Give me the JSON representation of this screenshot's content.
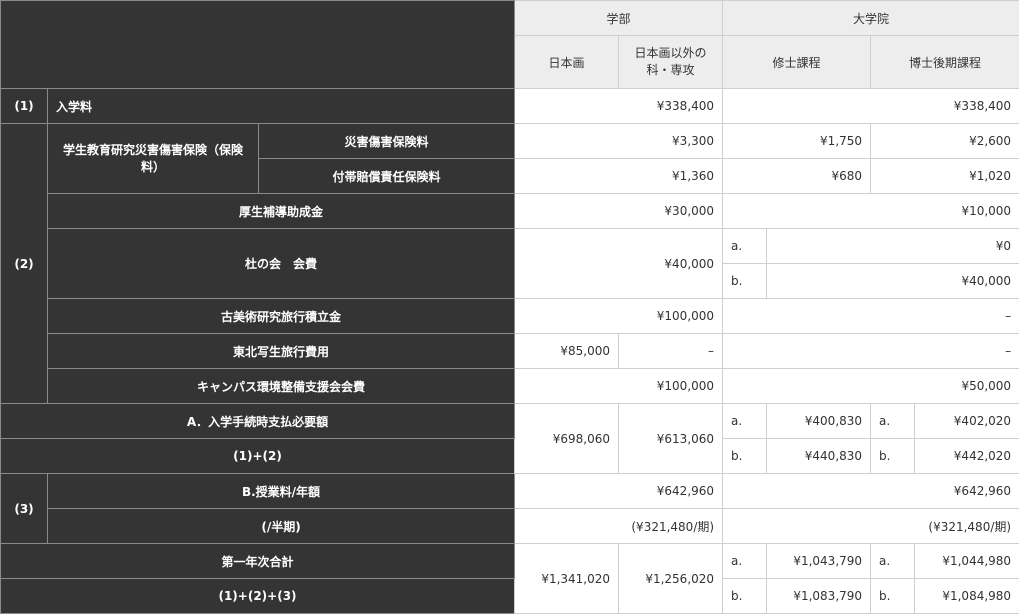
{
  "header": {
    "undergrad": "学部",
    "grad": "大学院",
    "nihonga": "日本画",
    "other_major": "日本画以外の科・専攻",
    "masters": "修士課程",
    "doctoral": "博士後期課程"
  },
  "row1": {
    "no": "(1)",
    "label": "入学料",
    "undergrad": "¥338,400",
    "grad": "¥338,400"
  },
  "group2": {
    "no": "(2)",
    "insurance_label": "学生教育研究災害傷害保険（保険料）",
    "disaster": {
      "label": "災害傷害保険料",
      "undergrad": "¥3,300",
      "masters": "¥1,750",
      "doctoral": "¥2,600"
    },
    "liability": {
      "label": "付帯賠償責任保険料",
      "undergrad": "¥1,360",
      "masters": "¥680",
      "doctoral": "¥1,020"
    },
    "welfare": {
      "label": "厚生補導助成金",
      "undergrad": "¥30,000",
      "grad": "¥10,000"
    },
    "mori": {
      "label": "杜の会　会費",
      "undergrad": "¥40,000",
      "a_mark": "a.",
      "a_value": "¥0",
      "b_mark": "b.",
      "b_value": "¥40,000"
    },
    "old_art": {
      "label": "古美術研究旅行積立金",
      "undergrad": "¥100,000",
      "grad": "–"
    },
    "tohoku": {
      "label": "東北写生旅行費用",
      "nihonga": "¥85,000",
      "other": "–",
      "grad": "–"
    },
    "campus": {
      "label": "キャンパス環境整備支援会会費",
      "undergrad": "¥100,000",
      "grad": "¥50,000"
    }
  },
  "totalA": {
    "label": "A．入学手続時支払必要額",
    "formula": "(1)+(2)",
    "nihonga": "¥698,060",
    "other": "¥613,060",
    "a_mark": "a.",
    "masters_a": "¥400,830",
    "doctoral_a": "¥402,020",
    "b_mark": "b.",
    "masters_b": "¥440,830",
    "doctoral_b": "¥442,020"
  },
  "row3": {
    "no": "(3)",
    "tuition_label": "B.授業料/年額",
    "tuition_undergrad": "¥642,960",
    "tuition_grad": "¥642,960",
    "half_label": "(/半期)",
    "half_undergrad": "(¥321,480/期)",
    "half_grad": "(¥321,480/期)"
  },
  "first_year": {
    "label": "第一年次合計",
    "formula": "(1)+(2)+(3)",
    "nihonga": "¥1,341,020",
    "other": "¥1,256,020",
    "a_mark": "a.",
    "masters_a": "¥1,043,790",
    "doctoral_a": "¥1,044,980",
    "b_mark": "b.",
    "masters_b": "¥1,083,790",
    "doctoral_b": "¥1,084,980"
  }
}
